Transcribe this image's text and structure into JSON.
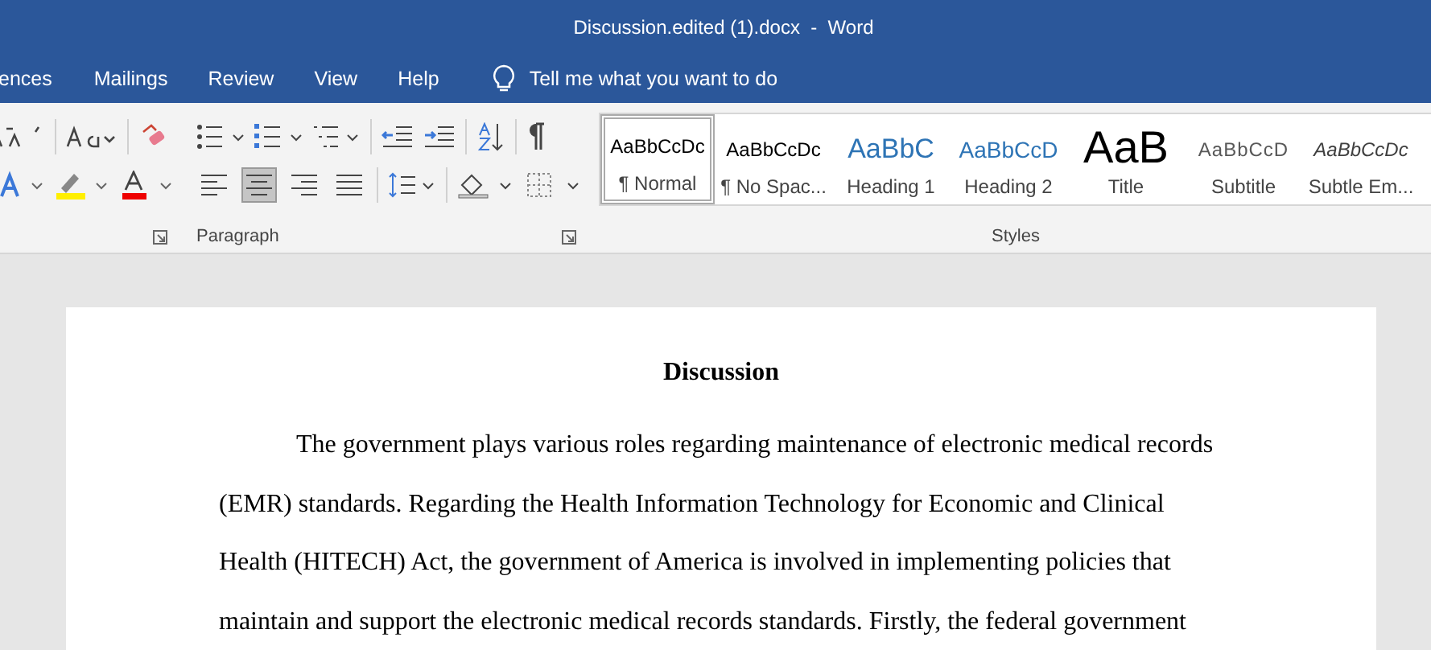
{
  "window": {
    "title": "Discussion.edited (1).docx  -  Word"
  },
  "tabs": [
    {
      "label": "ences",
      "selected": false
    },
    {
      "label": "Mailings",
      "selected": false
    },
    {
      "label": "Review",
      "selected": false
    },
    {
      "label": "View",
      "selected": false
    },
    {
      "label": "Help",
      "selected": false
    }
  ],
  "tell_me": {
    "placeholder": "Tell me what you want to do"
  },
  "paragraph_group": {
    "label": "Paragraph",
    "alignments": [
      {
        "kind": "left",
        "selected": false
      },
      {
        "kind": "center",
        "selected": true
      },
      {
        "kind": "right",
        "selected": false
      },
      {
        "kind": "justify",
        "selected": false
      }
    ]
  },
  "styles_group": {
    "label": "Styles",
    "items": [
      {
        "kind": "normal",
        "preview": "AaBbCcDc",
        "name": "¶ Normal",
        "selected": true
      },
      {
        "kind": "normal",
        "preview": "AaBbCcDc",
        "name": "¶ No Spac...",
        "selected": false
      },
      {
        "kind": "heading1",
        "preview": "AaBbC",
        "name": "Heading 1",
        "selected": false
      },
      {
        "kind": "heading2",
        "preview": "AaBbCcD",
        "name": "Heading 2",
        "selected": false
      },
      {
        "kind": "title",
        "preview": "AaB",
        "name": "Title",
        "selected": false
      },
      {
        "kind": "subtitle",
        "preview": "AaBbCcD",
        "name": "Subtitle",
        "selected": false
      },
      {
        "kind": "emphasis",
        "preview": "AaBbCcDc",
        "name": "Subtle Em...",
        "selected": false
      }
    ]
  },
  "document": {
    "heading": "Discussion",
    "paragraph": "The government plays various roles regarding maintenance of electronic medical records (EMR) standards. Regarding the Health Information Technology for Economic and Clinical Health (HITECH) Act, the government of America is involved in implementing policies that maintain and support the electronic medical records standards. Firstly, the federal government"
  }
}
